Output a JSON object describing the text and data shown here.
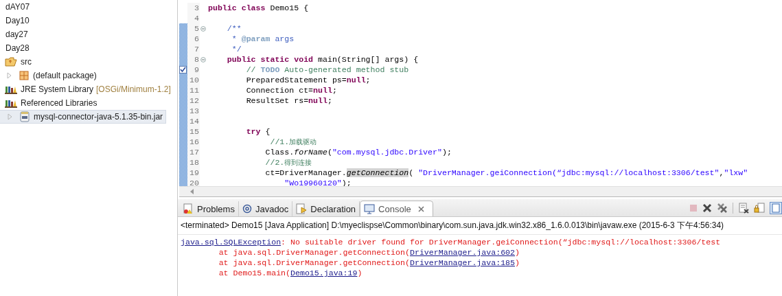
{
  "project_tree": [
    {
      "label": "dAY07",
      "selected": false
    },
    {
      "label": "Day10",
      "selected": false
    },
    {
      "label": "day27",
      "selected": false
    },
    {
      "label": "Day28",
      "selected": false,
      "children": [
        {
          "label": "src",
          "kind": "folder",
          "selected": false,
          "children": [
            {
              "label": "(default package)",
              "kind": "package",
              "selected": false
            }
          ]
        },
        {
          "label": "JRE System Library",
          "decoration": "[OSGi/Minimum-1.2]",
          "kind": "library",
          "selected": false
        },
        {
          "label": "Referenced Libraries",
          "kind": "library",
          "selected": false,
          "children": [
            {
              "label": "mysql-connector-java-5.1.35-bin.jar",
              "kind": "jar",
              "selected": true
            }
          ]
        }
      ]
    }
  ],
  "editor": {
    "lines": [
      {
        "number": "3",
        "tokens": [
          {
            "text": "public",
            "kind": "keyword"
          },
          {
            "text": " class",
            "kind": "keyword"
          },
          {
            "text": " Demo15 {",
            "kind": "plain"
          }
        ]
      },
      {
        "number": "4"
      },
      {
        "number": "5",
        "fold": true,
        "tokens": [
          {
            "text": "    /**",
            "kind": "javadoc"
          }
        ]
      },
      {
        "number": "6",
        "tokens": [
          {
            "text": "     * ",
            "kind": "javadoc"
          },
          {
            "text": "@param",
            "kind": "tag"
          },
          {
            "text": " args",
            "kind": "javadoc"
          }
        ]
      },
      {
        "number": "7",
        "tokens": [
          {
            "text": "     */",
            "kind": "javadoc"
          }
        ]
      },
      {
        "number": "8",
        "fold": true,
        "tokens": [
          {
            "text": "    public",
            "kind": "keyword"
          },
          {
            "text": " static",
            "kind": "keyword"
          },
          {
            "text": " void",
            "kind": "keyword"
          },
          {
            "text": " main(String[] args) {",
            "kind": "plain"
          }
        ]
      },
      {
        "number": "9",
        "task": true,
        "tokens": [
          {
            "text": "        // ",
            "kind": "comment"
          },
          {
            "text": "TODO",
            "kind": "todo"
          },
          {
            "text": " Auto-generated method stub",
            "kind": "comment"
          }
        ]
      },
      {
        "number": "10",
        "tokens": [
          {
            "text": "        PreparedStatement ps=",
            "kind": "plain"
          },
          {
            "text": "null",
            "kind": "keyword"
          },
          {
            "text": ";",
            "kind": "plain"
          }
        ]
      },
      {
        "number": "11",
        "tokens": [
          {
            "text": "        Connection ct=",
            "kind": "plain"
          },
          {
            "text": "null",
            "kind": "keyword"
          },
          {
            "text": ";",
            "kind": "plain"
          }
        ]
      },
      {
        "number": "12",
        "tokens": [
          {
            "text": "        ResultSet rs=",
            "kind": "plain"
          },
          {
            "text": "null",
            "kind": "keyword"
          },
          {
            "text": ";",
            "kind": "plain"
          }
        ]
      },
      {
        "number": "13"
      },
      {
        "number": "14"
      },
      {
        "number": "15",
        "tokens": [
          {
            "text": "        try",
            "kind": "keyword"
          },
          {
            "text": " {",
            "kind": "plain"
          }
        ]
      },
      {
        "number": "16",
        "tokens": [
          {
            "text": "             //1.",
            "kind": "comment"
          },
          {
            "text": "加载驱动",
            "kind": "cjk"
          }
        ]
      },
      {
        "number": "17",
        "tokens": [
          {
            "text": "            Class.",
            "kind": "plain"
          },
          {
            "text": "forName",
            "kind": "static"
          },
          {
            "text": "(",
            "kind": "plain"
          },
          {
            "text": "\"com.mysql.jdbc.Driver\"",
            "kind": "string"
          },
          {
            "text": ");",
            "kind": "plain"
          }
        ]
      },
      {
        "number": "18",
        "tokens": [
          {
            "text": "            //2.",
            "kind": "comment"
          },
          {
            "text": "得到连接",
            "kind": "cjk"
          }
        ]
      },
      {
        "number": "19",
        "tokens": [
          {
            "text": "            ct=DriverManager.",
            "kind": "plain"
          },
          {
            "text": "getConnection",
            "kind": "marked"
          },
          {
            "text": "( ",
            "kind": "plain"
          },
          {
            "text": "\"DriverManager.geiConnection(“jdbc:mysql://localhost:3306/test\"",
            "kind": "string"
          },
          {
            "text": ",",
            "kind": "plain"
          },
          {
            "text": "\"lxw\"",
            "kind": "string"
          }
        ]
      },
      {
        "number": "20",
        "tokens": [
          {
            "text": "                \"Wo19960120\"",
            "kind": "string"
          },
          {
            "text": ");",
            "kind": "plain"
          }
        ]
      }
    ]
  },
  "console": {
    "tabs": [
      {
        "label": "Problems",
        "kind": "problems",
        "selected": false
      },
      {
        "label": "Javadoc",
        "kind": "javadoc",
        "selected": false
      },
      {
        "label": "Declaration",
        "kind": "declaration",
        "selected": false
      },
      {
        "label": "Console",
        "kind": "console",
        "selected": true
      }
    ],
    "header": "<terminated> Demo15 [Java Application] D:\\myeclispse\\Common\\binary\\com.sun.java.jdk.win32.x86_1.6.0.013\\bin\\javaw.exe (2015-6-3 下午4:56:34)",
    "output": [
      [
        {
          "text": "java.sql.SQLException",
          "kind": "link"
        },
        {
          "text": ": No suitable driver found for DriverManager.geiConnection(“jdbc:mysql://localhost:3306/test",
          "kind": "error"
        }
      ],
      [
        {
          "text": "        at java.sql.DriverManager.getConnection(",
          "kind": "error"
        },
        {
          "text": "DriverManager.java:602",
          "kind": "link"
        },
        {
          "text": ")",
          "kind": "error"
        }
      ],
      [
        {
          "text": "        at java.sql.DriverManager.getConnection(",
          "kind": "error"
        },
        {
          "text": "DriverManager.java:185",
          "kind": "link"
        },
        {
          "text": ")",
          "kind": "error"
        }
      ],
      [
        {
          "text": "        at Demo15.main(",
          "kind": "error"
        },
        {
          "text": "Demo15.java:19",
          "kind": "link"
        },
        {
          "text": ")",
          "kind": "error"
        }
      ]
    ]
  }
}
